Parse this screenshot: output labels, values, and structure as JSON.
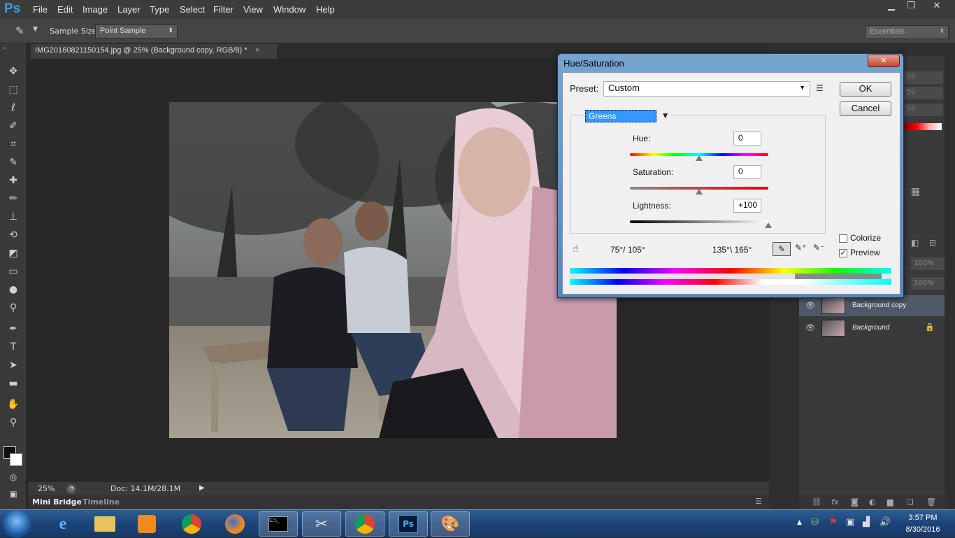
{
  "app": {
    "logo": "Ps"
  },
  "menu": [
    "File",
    "Edit",
    "Image",
    "Layer",
    "Type",
    "Select",
    "Filter",
    "View",
    "Window",
    "Help"
  ],
  "options": {
    "sample_size_label": "Sample Size:",
    "sample_size_value": "Point Sample",
    "workspace": "Essentials"
  },
  "document": {
    "tab_title": "IMG20160821150154.jpg @ 25% (Background copy, RGB/8) *",
    "tab_close": "×"
  },
  "status": {
    "zoom": "25%",
    "doc_size": "Doc: 14.1M/28.1M"
  },
  "bottom_tabs": [
    "Mini Bridge",
    "Timeline"
  ],
  "layers": {
    "opacity_value": "100%",
    "fill_value": "100%",
    "items": [
      {
        "name": "Background copy",
        "selected": true
      },
      {
        "name": "Background",
        "locked": true
      }
    ],
    "ghost_values": [
      "50",
      "50",
      "50"
    ]
  },
  "dialog": {
    "title": "Hue/Saturation",
    "close": "✕",
    "preset_label": "Preset:",
    "preset_value": "Custom",
    "ok": "OK",
    "cancel": "Cancel",
    "channel": "Greens",
    "hue_label": "Hue:",
    "hue_value": "0",
    "saturation_label": "Saturation:",
    "saturation_value": "0",
    "lightness_label": "Lightness:",
    "lightness_value": "+100",
    "hue_level": 0.5,
    "saturation_level": 0.5,
    "lightness_level": 1.0,
    "range_left": "75°/ 105°",
    "range_right": "135°\\ 165°",
    "colorize_label": "Colorize",
    "colorize_checked": false,
    "preview_label": "Preview",
    "preview_checked": true,
    "preview_check_glyph": "✓"
  },
  "taskbar": {
    "time": "3:57 PM",
    "date": "8/30/2016",
    "apps": [
      "internet-explorer",
      "file-explorer",
      "media-player",
      "chrome",
      "firefox",
      "command-prompt",
      "snipping-tool",
      "chrome",
      "photoshop",
      "paint"
    ]
  }
}
